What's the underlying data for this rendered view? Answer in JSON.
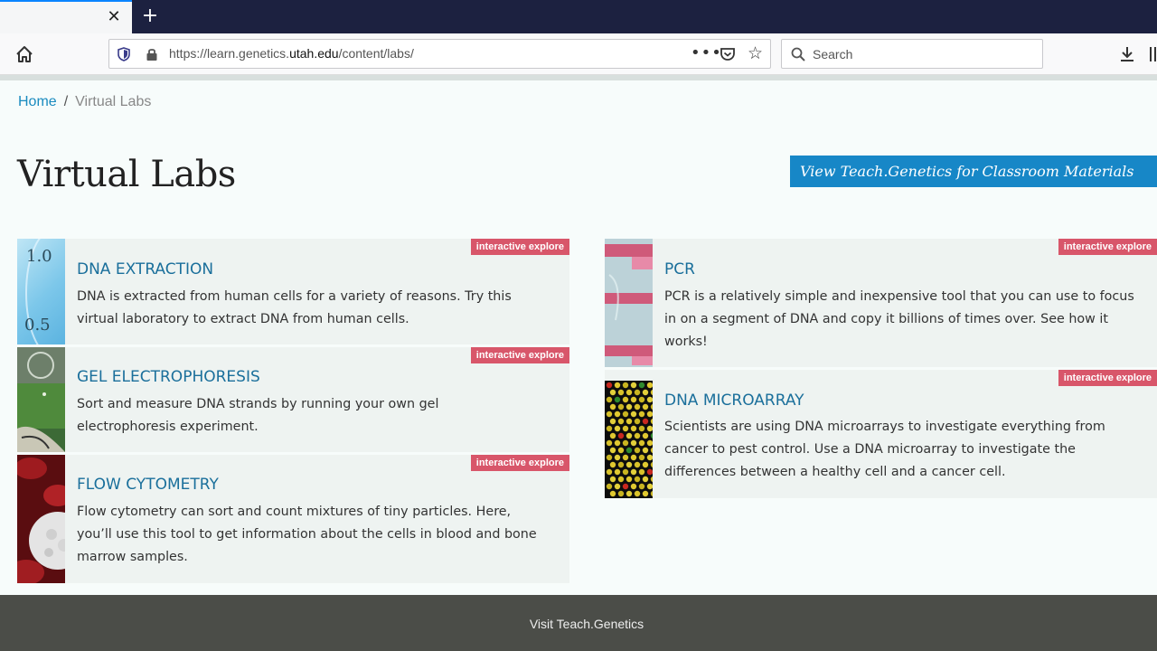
{
  "browser": {
    "tab_close": "✕",
    "new_tab": "+",
    "url_prefix": "https://learn.genetics.",
    "url_domain": "utah.edu",
    "url_suffix": "/content/labs/",
    "search_placeholder": "Search"
  },
  "breadcrumb": {
    "home": "Home",
    "separator": "/",
    "current": "Virtual Labs"
  },
  "page": {
    "title": "Virtual Labs",
    "teach_button": "View Teach.Genetics for Classroom Materials"
  },
  "labs": [
    {
      "badge": "interactive explore",
      "title": "DNA EXTRACTION",
      "desc": "DNA is extracted from human cells for a variety of reasons. Try this virtual laboratory to extract DNA from human cells.",
      "thumb_labels": [
        "1.0",
        "0.5"
      ]
    },
    {
      "badge": "interactive explore",
      "title": "GEL ELECTROPHORESIS",
      "desc": "Sort and measure DNA strands by running your own gel electrophoresis experiment."
    },
    {
      "badge": "interactive explore",
      "title": "FLOW CYTOMETRY",
      "desc": "Flow cytometry can sort and count mixtures of tiny particles. Here, you’ll use this tool to get information about the cells in blood and bone marrow samples."
    },
    {
      "badge": "interactive explore",
      "title": "PCR",
      "desc": "PCR is a relatively simple and inexpensive tool that you can use to focus in on a segment of DNA and copy it billions of times over. See how it works!"
    },
    {
      "badge": "interactive explore",
      "title": "DNA MICROARRAY",
      "desc": "Scientists are using DNA microarrays to investigate everything from cancer to pest control. Use a DNA microarray to investigate the differences between a healthy cell and a cancer cell."
    }
  ],
  "footer": {
    "link": "Visit Teach.Genetics"
  },
  "colors": {
    "accent": "#1787c7",
    "badge": "#d8566a",
    "link": "#1a6f9b",
    "footer": "#4b4d48"
  }
}
